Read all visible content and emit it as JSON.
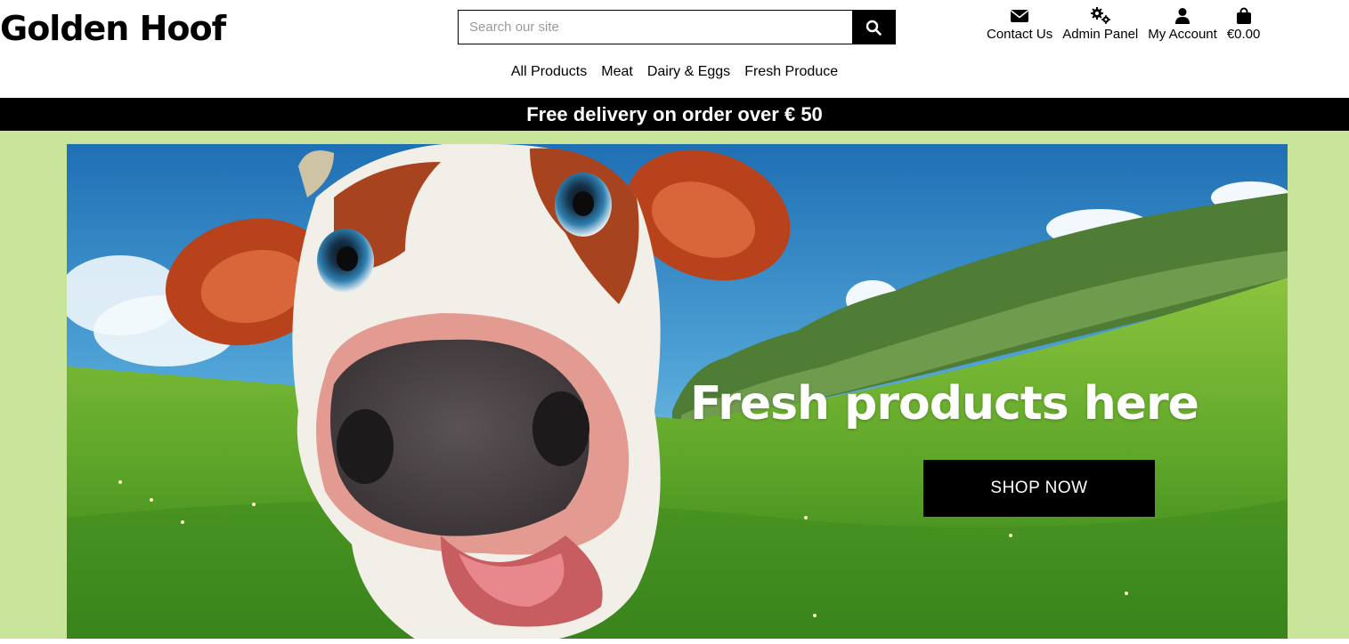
{
  "header": {
    "logo": "Golden Hoof",
    "search": {
      "placeholder": "Search our site",
      "button_icon": "search-icon"
    },
    "account_nav": [
      {
        "label": "Contact Us",
        "icon": "envelope-icon"
      },
      {
        "label": "Admin Panel",
        "icon": "gears-icon"
      },
      {
        "label": "My Account",
        "icon": "user-icon"
      },
      {
        "label": "€0.00",
        "icon": "shopping-bag-icon"
      }
    ],
    "main_nav": [
      "All Products",
      "Meat",
      "Dairy & Eggs",
      "Fresh Produce"
    ]
  },
  "banner": {
    "text": "Free delivery on order over € 50"
  },
  "hero": {
    "title": "Fresh products here",
    "button_label": "SHOP NOW"
  },
  "colors": {
    "page_background": "#c9e59a",
    "banner_background": "#000000",
    "button_background": "#000000"
  }
}
